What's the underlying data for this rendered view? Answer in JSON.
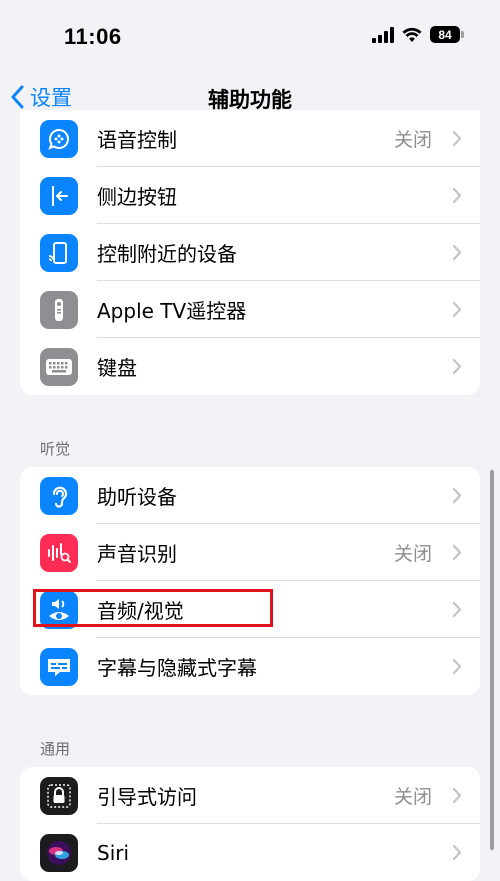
{
  "status": {
    "time": "11:06",
    "battery": "84"
  },
  "nav": {
    "back_label": "设置",
    "title": "辅助功能"
  },
  "groups": [
    {
      "items": [
        {
          "label": "语音控制",
          "value": "关闭"
        },
        {
          "label": "侧边按钮",
          "value": ""
        },
        {
          "label": "控制附近的设备",
          "value": ""
        },
        {
          "label": "Apple TV遥控器",
          "value": ""
        },
        {
          "label": "键盘",
          "value": ""
        }
      ]
    },
    {
      "header": "听觉",
      "items": [
        {
          "label": "助听设备",
          "value": ""
        },
        {
          "label": "声音识别",
          "value": "关闭"
        },
        {
          "label": "音频/视觉",
          "value": ""
        },
        {
          "label": "字幕与隐藏式字幕",
          "value": ""
        }
      ]
    },
    {
      "header": "通用",
      "items": [
        {
          "label": "引导式访问",
          "value": "关闭"
        },
        {
          "label": "Siri",
          "value": ""
        }
      ]
    }
  ],
  "colors": {
    "accent": "#0a84ff",
    "blue_icon": "#0a84ff",
    "gray_icon": "#8e8e93",
    "pink_icon": "#ff2d55",
    "dark_icon": "#1c1c1e",
    "highlight": "#e0141e"
  },
  "icons": {
    "voice_control": "voice-control-icon",
    "side_button": "side-button-icon",
    "nearby_devices": "nearby-devices-icon",
    "apple_tv_remote": "apple-tv-remote-icon",
    "keyboard": "keyboard-icon",
    "hearing_devices": "ear-icon",
    "sound_recognition": "sound-recognition-icon",
    "audio_visual": "audio-visual-icon",
    "subtitles": "subtitles-icon",
    "guided_access": "lock-icon",
    "siri": "siri-icon"
  }
}
